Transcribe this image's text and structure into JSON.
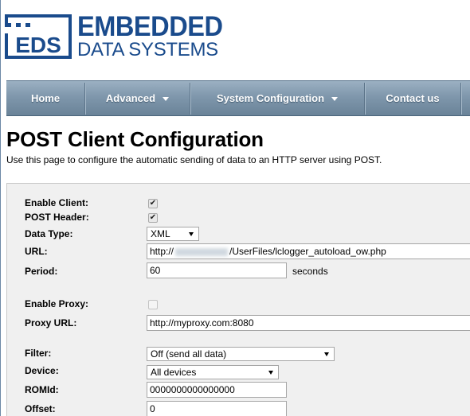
{
  "brand": {
    "mark": "EDS",
    "line1": "EMBEDDED",
    "line2": "DATA SYSTEMS"
  },
  "nav": {
    "items": [
      {
        "label": "Home",
        "dropdown": false
      },
      {
        "label": "Advanced",
        "dropdown": true
      },
      {
        "label": "System Configuration",
        "dropdown": true
      },
      {
        "label": "Contact us",
        "dropdown": false
      }
    ]
  },
  "page": {
    "title": "POST Client Configuration",
    "description": "Use this page to configure the automatic sending of data to an HTTP server using POST."
  },
  "form": {
    "enable_client": {
      "label": "Enable Client:",
      "checked": true
    },
    "post_header": {
      "label": "POST Header:",
      "checked": true
    },
    "data_type": {
      "label": "Data Type:",
      "value": "XML"
    },
    "url": {
      "label": "URL:",
      "prefix": "http://",
      "suffix": "/UserFiles/lclogger_autoload_ow.php"
    },
    "period": {
      "label": "Period:",
      "value": "60",
      "unit": "seconds"
    },
    "enable_proxy": {
      "label": "Enable Proxy:",
      "checked": false
    },
    "proxy_url": {
      "label": "Proxy URL:",
      "value": "http://myproxy.com:8080"
    },
    "filter": {
      "label": "Filter:",
      "value": "Off (send all data)"
    },
    "device": {
      "label": "Device:",
      "value": "All devices"
    },
    "romid": {
      "label": "ROMId:",
      "value": "0000000000000000"
    },
    "offset": {
      "label": "Offset:",
      "value": "0"
    }
  },
  "colors": {
    "brand_blue": "#1a4b8c",
    "nav_bg": "#7f97ac"
  }
}
